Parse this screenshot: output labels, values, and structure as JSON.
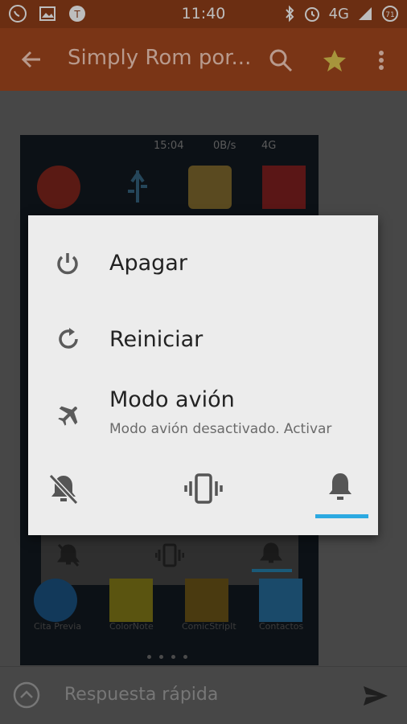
{
  "status_bar": {
    "time": "11:40",
    "network": "4G",
    "network_small": "4G",
    "battery": "71"
  },
  "app_bar": {
    "title": "Simply Rom por...",
    "back_icon": "arrow-back-icon",
    "search_icon": "search-icon",
    "star_icon": "star-icon",
    "menu_icon": "more-vert-icon"
  },
  "background_screenshot": {
    "time": "15:04",
    "speed": "0B/s",
    "network": "4G",
    "apps": [
      "Cita Previa",
      "ColorNote",
      "ComicStripIt",
      "Contactos"
    ]
  },
  "power_dialog": {
    "items": [
      {
        "label": "Apagar",
        "icon": "power-icon"
      },
      {
        "label": "Reiniciar",
        "icon": "restart-icon"
      },
      {
        "label": "Modo avión",
        "sublabel": "Modo avión desactivado. Activar",
        "icon": "airplane-icon"
      }
    ],
    "sound_modes": [
      {
        "name": "silent",
        "icon": "bell-off-icon"
      },
      {
        "name": "vibrate",
        "icon": "vibrate-icon"
      },
      {
        "name": "sound",
        "icon": "bell-icon",
        "selected": true
      }
    ],
    "accent_color": "#2ca9e1"
  },
  "reply_bar": {
    "placeholder": "Respuesta rápida"
  }
}
